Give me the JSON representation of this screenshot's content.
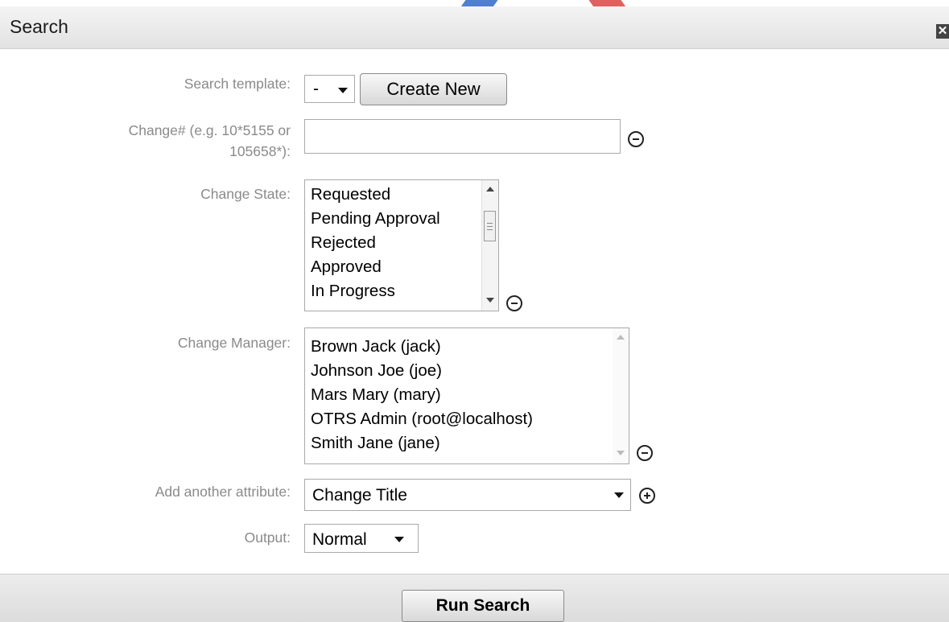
{
  "dialog": {
    "title": "Search"
  },
  "form": {
    "search_template": {
      "label": "Search template:",
      "selected": "-",
      "create_button": "Create New"
    },
    "change_number": {
      "label_line1": "Change# (e.g. 10*5155 or",
      "label_line2": "105658*):",
      "value": ""
    },
    "change_state": {
      "label": "Change State:",
      "options": [
        "Requested",
        "Pending Approval",
        "Rejected",
        "Approved",
        "In Progress"
      ]
    },
    "change_manager": {
      "label": "Change Manager:",
      "options": [
        "Brown Jack (jack)",
        "Johnson Joe (joe)",
        "Mars Mary (mary)",
        "OTRS Admin (root@localhost)",
        "Smith Jane (jane)"
      ]
    },
    "add_attribute": {
      "label": "Add another attribute:",
      "selected": "Change Title"
    },
    "output": {
      "label": "Output:",
      "selected": "Normal"
    }
  },
  "footer": {
    "run_button": "Run Search"
  },
  "icons": {
    "close": "close-icon",
    "remove": "minus-circle-icon",
    "add": "plus-circle-icon",
    "dropdown": "chevron-down-icon"
  }
}
